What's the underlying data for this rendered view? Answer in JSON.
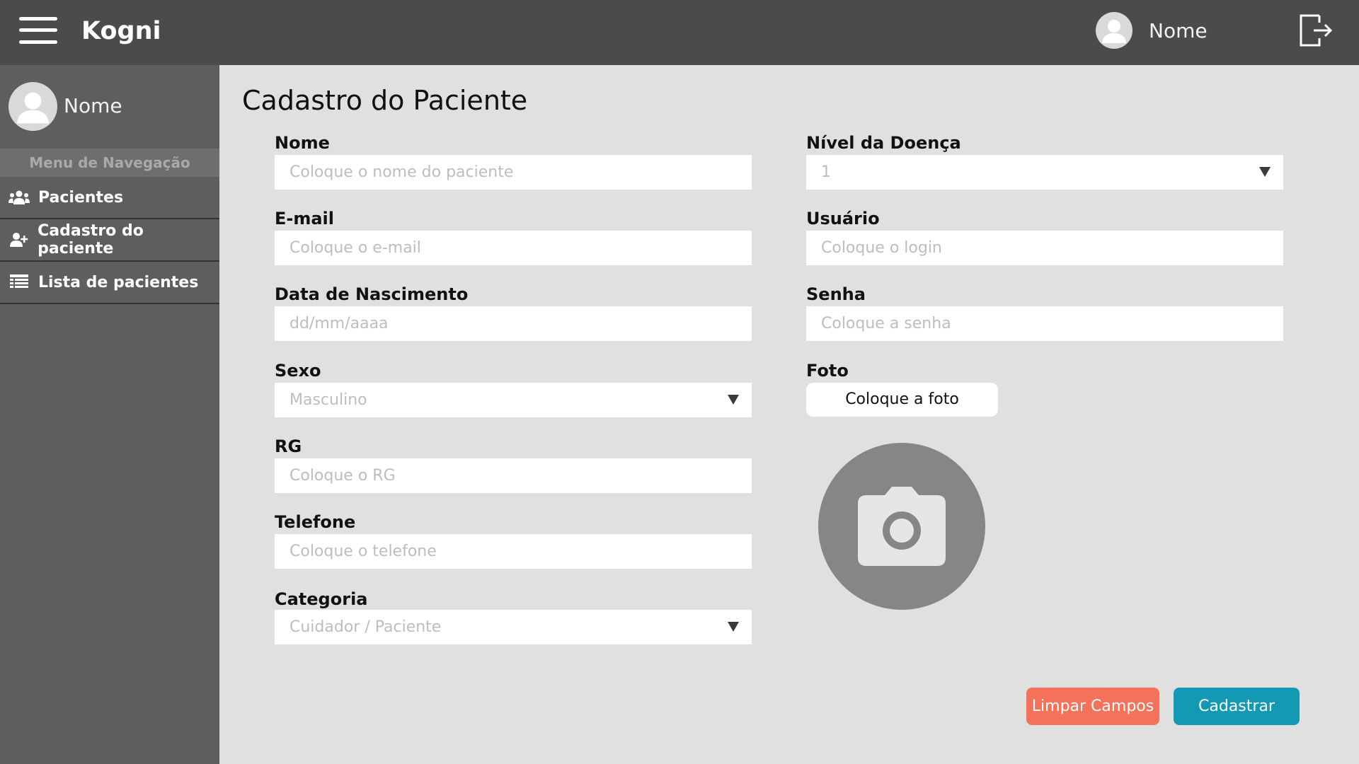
{
  "header": {
    "brand": "Kogni",
    "user_name": "Nome"
  },
  "sidebar": {
    "user_name": "Nome",
    "menu_title": "Menu de Navegação",
    "items": [
      {
        "label": "Pacientes",
        "icon": "users-icon"
      },
      {
        "label": "Cadastro do paciente",
        "icon": "user-plus-icon"
      },
      {
        "label": "Lista de pacientes",
        "icon": "list-icon"
      }
    ]
  },
  "main": {
    "title": "Cadastro do Paciente",
    "fields": {
      "nome": {
        "label": "Nome",
        "placeholder": "Coloque o nome do paciente"
      },
      "email": {
        "label": "E-mail",
        "placeholder": "Coloque o e-mail"
      },
      "nascimento": {
        "label": "Data de Nascimento",
        "placeholder": "dd/mm/aaaa"
      },
      "sexo": {
        "label": "Sexo",
        "value": "Masculino"
      },
      "rg": {
        "label": "RG",
        "placeholder": "Coloque o RG"
      },
      "telefone": {
        "label": "Telefone",
        "placeholder": "Coloque o telefone"
      },
      "categoria": {
        "label": "Categoria",
        "value": "Cuidador / Paciente"
      },
      "nivel": {
        "label": "Nível da Doença",
        "value": "1"
      },
      "usuario": {
        "label": "Usuário",
        "placeholder": "Coloque o login"
      },
      "senha": {
        "label": "Senha",
        "placeholder": "Coloque a senha"
      },
      "foto": {
        "label": "Foto",
        "button": "Coloque a foto"
      }
    },
    "buttons": {
      "clear": "Limpar Campos",
      "submit": "Cadastrar"
    }
  },
  "colors": {
    "topbar": "#4b4b4b",
    "sidebar": "#5e5e5e",
    "background": "#e0e0e0",
    "clear_button": "#f4725a",
    "submit_button": "#1499b4"
  }
}
